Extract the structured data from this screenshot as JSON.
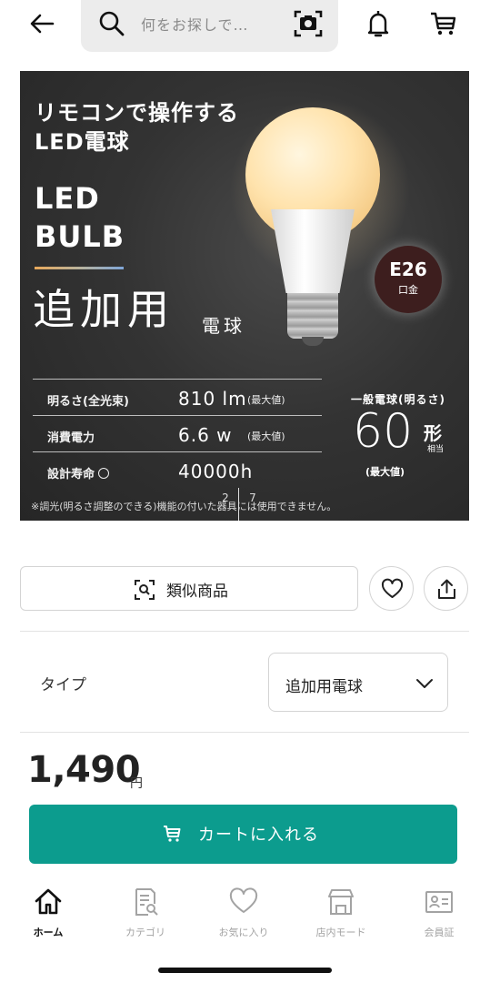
{
  "header": {
    "search_placeholder": "何をお探しで…"
  },
  "product_image": {
    "headline_line1": "リモコンで操作する",
    "headline_line2": "LED電球",
    "led_word": "LED",
    "bulb_word": "BULB",
    "addon_big": "追加用",
    "addon_small": "電球",
    "socket_type": "E26",
    "socket_sub": "口金",
    "specs": [
      {
        "label": "明るさ(全光束)",
        "value": "810 lm",
        "note": "(最大値)"
      },
      {
        "label": "消費電力",
        "value": "6.6 w",
        "note": "(最大値)"
      },
      {
        "label": "設計寿命",
        "value": "40000h",
        "note": ""
      }
    ],
    "equivalent_caption": "一般電球(明るさ)",
    "equivalent_value": "60",
    "equivalent_unit": "形",
    "equivalent_sub": "相当",
    "equivalent_max": "(最大値)",
    "disclaimer": "※調光(明るさ調整のできる)機能の付いた器具には使用できません。",
    "pager_current": "2",
    "pager_total": "7"
  },
  "actions": {
    "similar_label": "類似商品"
  },
  "type_selector": {
    "label": "タイプ",
    "selected": "追加用電球"
  },
  "price": {
    "amount": "1,490",
    "unit": "円"
  },
  "cart_button": {
    "label": "カートに入れる"
  },
  "bottom_nav": {
    "items": [
      {
        "label": "ホーム",
        "icon": "home-icon"
      },
      {
        "label": "カテゴリ",
        "icon": "category-icon"
      },
      {
        "label": "お気に入り",
        "icon": "heart-icon"
      },
      {
        "label": "店内モード",
        "icon": "store-icon"
      },
      {
        "label": "会員証",
        "icon": "member-card-icon"
      }
    ]
  },
  "colors": {
    "accent": "#0c9c8e",
    "nav_active": "#111111",
    "nav_inactive": "#a3a3a3"
  }
}
